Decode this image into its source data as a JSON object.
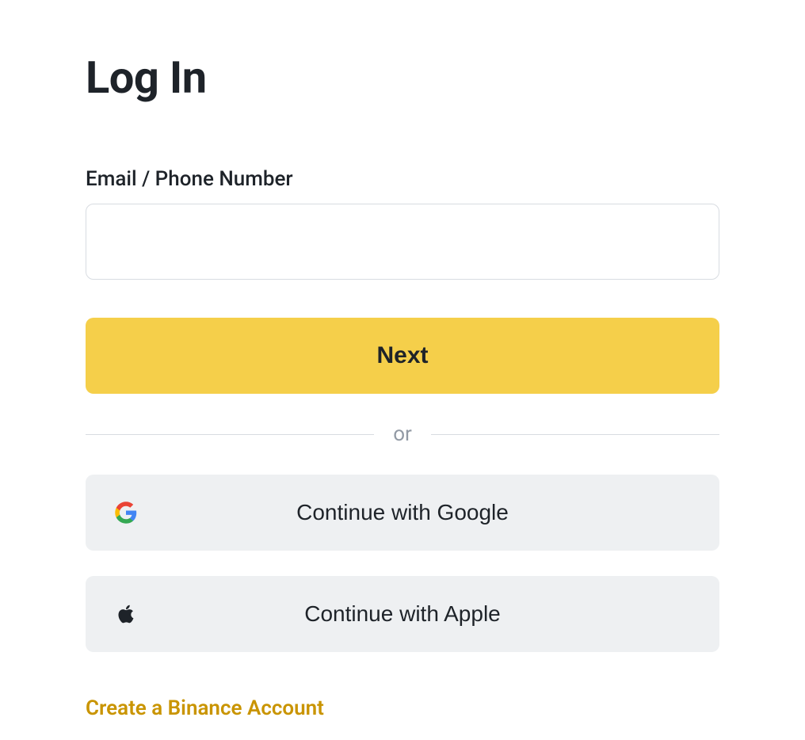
{
  "title": "Log In",
  "form": {
    "field_label": "Email / Phone Number",
    "field_value": "",
    "submit_label": "Next"
  },
  "divider_text": "or",
  "social": {
    "google_label": "Continue with Google",
    "apple_label": "Continue with Apple"
  },
  "create_account_link": "Create a Binance Account"
}
